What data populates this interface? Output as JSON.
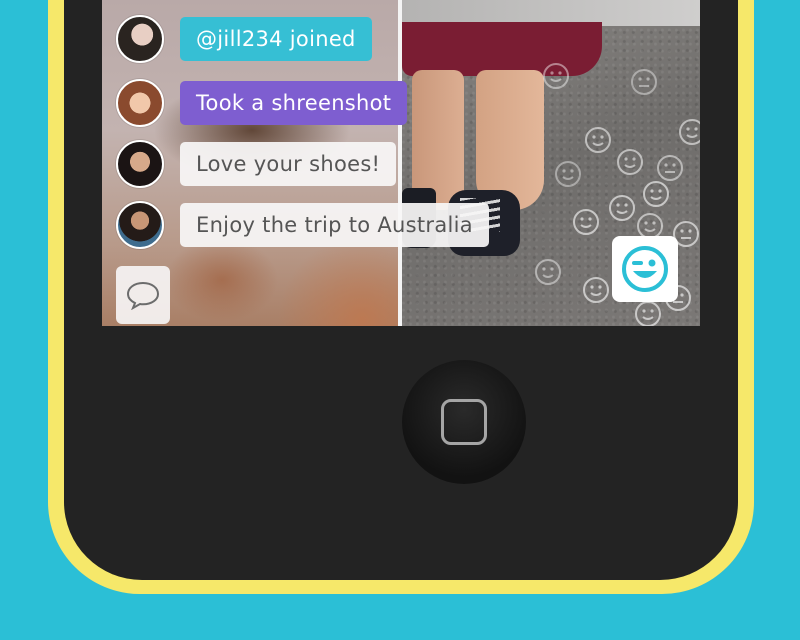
{
  "chat": {
    "messages": [
      {
        "text": "@jill234 joined",
        "style": "teal"
      },
      {
        "text": "Took a shreenshot",
        "style": "purple"
      },
      {
        "text": "Love your shoes!",
        "style": "light"
      },
      {
        "text": "Enjoy the trip to Australia",
        "style": "light"
      }
    ]
  },
  "colors": {
    "background": "#2bbfd6",
    "phone_frame": "#f6e86a",
    "accent_teal": "#36bfd4",
    "accent_purple": "#7e5ed0"
  },
  "icons": {
    "chat": "speech-bubble-icon",
    "emoji": "winking-smiley-icon",
    "home": "home-button-square-icon"
  }
}
